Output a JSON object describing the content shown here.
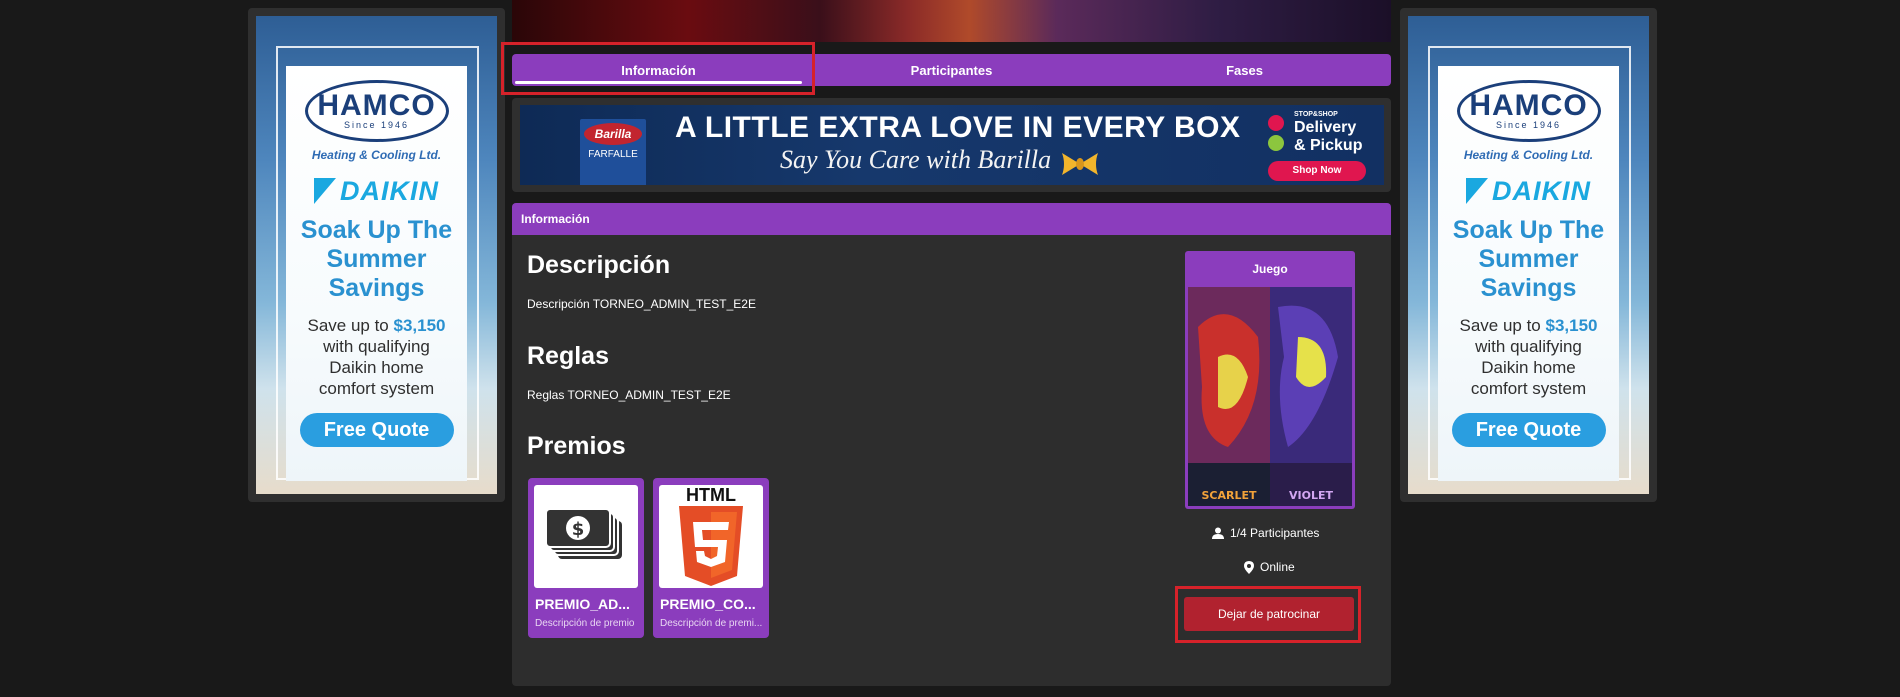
{
  "tabs": [
    {
      "label": "Información",
      "active": true
    },
    {
      "label": "Participantes",
      "active": false
    },
    {
      "label": "Fases",
      "active": false
    }
  ],
  "banner_ad": {
    "product_brand": "Barilla",
    "product_label": "FARFALLE",
    "headline": "A LITTLE EXTRA LOVE IN EVERY BOX",
    "subline": "Say You Care with Barilla",
    "store_small": "STOP&SHOP",
    "store_line1": "Delivery",
    "store_line2": "& Pickup",
    "cta": "Shop Now"
  },
  "side_ad": {
    "brand": "HAMCO",
    "since": "Since 1946",
    "company": "Heating & Cooling Ltd.",
    "partner": "DAIKIN",
    "headline_lines": [
      "Soak Up The",
      "Summer",
      "Savings"
    ],
    "body_prefix": "Save up to ",
    "body_price": "$3,150",
    "body_rest_lines": [
      "with qualifying",
      "Daikin home",
      "comfort system"
    ],
    "cta": "Free Quote"
  },
  "info": {
    "header": "Información",
    "description_title": "Descripción",
    "description_text": "Descripción TORNEO_ADMIN_TEST_E2E",
    "rules_title": "Reglas",
    "rules_text": "Reglas TORNEO_ADMIN_TEST_E2E",
    "prizes_title": "Premios",
    "prizes": [
      {
        "name": "PREMIO_AD...",
        "description": "Descripción de premio",
        "icon": "money-stack-icon"
      },
      {
        "name": "PREMIO_CO...",
        "description": "Descripción de premi...",
        "icon": "html5-icon",
        "icon_text": "HTML"
      }
    ]
  },
  "game": {
    "label": "Juego",
    "title_left": "SCARLET",
    "title_right": "VIOLET",
    "participants": "1/4 Participantes",
    "location": "Online",
    "action": "Dejar de patrocinar"
  },
  "colors": {
    "accent_purple": "#8b3dbd",
    "panel": "#2d2d2d",
    "background": "#191919",
    "danger": "#b1222f",
    "highlight": "#d6222a"
  }
}
